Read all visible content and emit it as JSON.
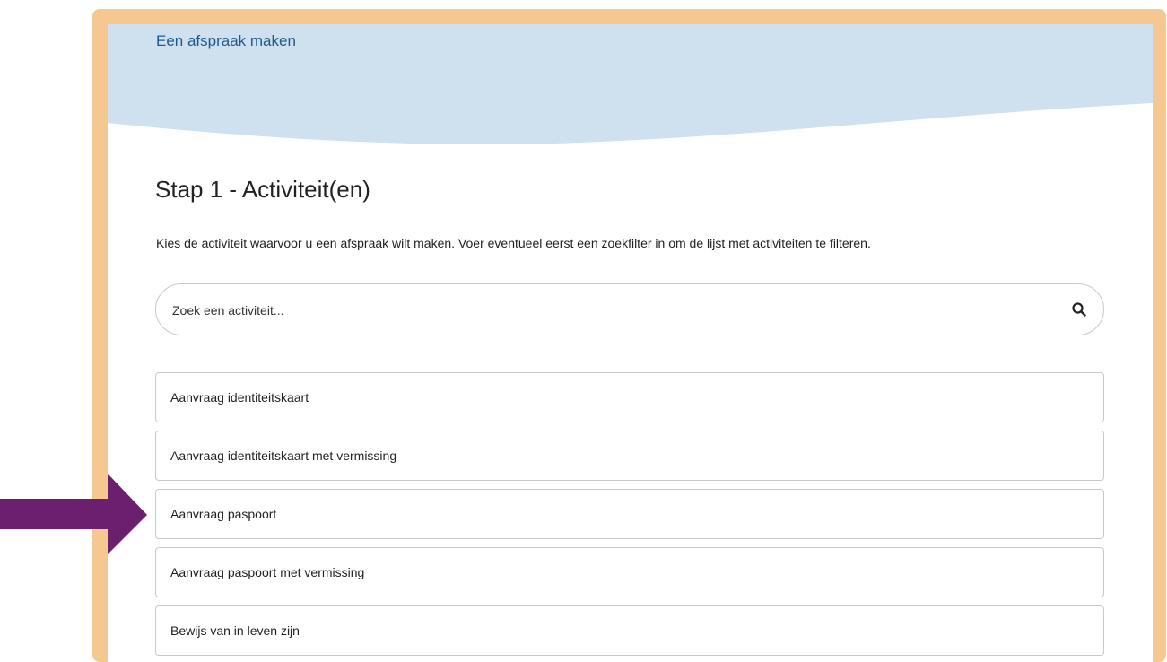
{
  "header": {
    "link_label": "Een afspraak maken"
  },
  "step": {
    "title": "Stap 1 - Activiteit(en)",
    "intro": "Kies de activiteit waarvoor u een afspraak wilt maken. Voer eventueel eerst een zoekfilter in om de lijst met activiteiten te filteren."
  },
  "search": {
    "placeholder": "Zoek een activiteit...",
    "icon": "search-icon"
  },
  "activities": [
    {
      "label": "Aanvraag identiteitskaart"
    },
    {
      "label": "Aanvraag identiteitskaart met vermissing"
    },
    {
      "label": "Aanvraag paspoort"
    },
    {
      "label": "Aanvraag paspoort met vermissing"
    },
    {
      "label": "Bewijs van in leven zijn"
    }
  ],
  "colors": {
    "frame": "#f5c892",
    "header_wave": "#cfe0ee",
    "link": "#1d5a8e",
    "highlight_arrow": "#6b1f6e"
  }
}
